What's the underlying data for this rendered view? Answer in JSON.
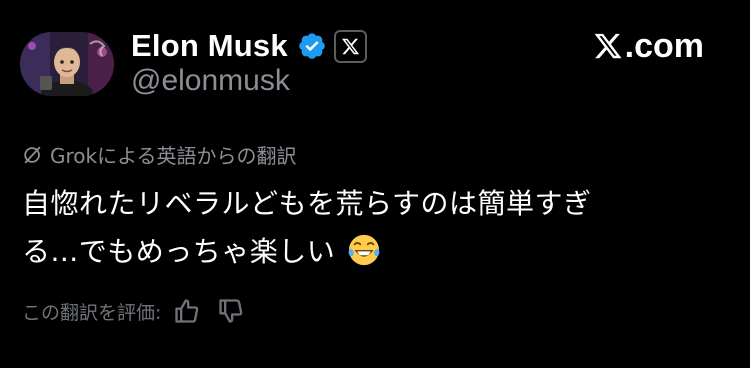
{
  "author": {
    "name": "Elon Musk",
    "handle": "@elonmusk",
    "verified_color": "#1d9bf0",
    "icons": [
      "avatar",
      "verified-badge-icon",
      "x-affiliate-badge-icon"
    ]
  },
  "brand": {
    "logo": "x-logo-icon",
    "text": ".com"
  },
  "translation": {
    "icon": "translate-icon",
    "label": "Grokによる英語からの翻訳"
  },
  "tweet": {
    "line1": "自惚れたリベラルどもを荒らすのは簡単すぎ",
    "line2": "る...でもめっちゃ楽しい",
    "emoji": "face-with-tears-of-joy"
  },
  "rating": {
    "label": "この翻訳を評価:",
    "icons": [
      "thumbs-up-icon",
      "thumbs-down-icon"
    ]
  },
  "colors": {
    "background": "#000000",
    "primary_text": "#ffffff",
    "secondary_text": "#8b8f95"
  }
}
